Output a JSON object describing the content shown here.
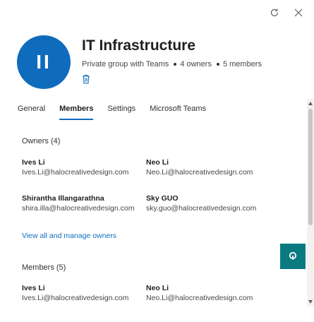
{
  "group": {
    "avatar_initials": "II",
    "title": "IT Infrastructure",
    "privacy": "Private group with Teams",
    "owners_count": "4 owners",
    "members_count": "5 members"
  },
  "tabs": [
    {
      "label": "General",
      "active": false
    },
    {
      "label": "Members",
      "active": true
    },
    {
      "label": "Settings",
      "active": false
    },
    {
      "label": "Microsoft Teams",
      "active": false
    }
  ],
  "owners": {
    "heading": "Owners (4)",
    "people": [
      {
        "name": "Ives Li",
        "email": "Ives.Li@halocreativedesign.com"
      },
      {
        "name": "Neo Li",
        "email": "Neo.Li@halocreativedesign.com"
      },
      {
        "name": "Shirantha Illangarathna",
        "email": "shira.illa@halocreativedesign.com"
      },
      {
        "name": "Sky GUO",
        "email": "sky.guo@halocreativedesign.com"
      }
    ],
    "manage_link": "View all and manage owners"
  },
  "members": {
    "heading": "Members (5)",
    "people": [
      {
        "name": "Ives Li",
        "email": "Ives.Li@halocreativedesign.com"
      },
      {
        "name": "Neo Li",
        "email": "Neo.Li@halocreativedesign.com"
      }
    ]
  },
  "icons": {
    "refresh": "refresh-icon",
    "close": "close-icon",
    "delete": "trash-icon",
    "assistant": "chat-assistant-icon"
  },
  "colors": {
    "accent": "#0f6cbd",
    "fab": "#0b7a80"
  }
}
